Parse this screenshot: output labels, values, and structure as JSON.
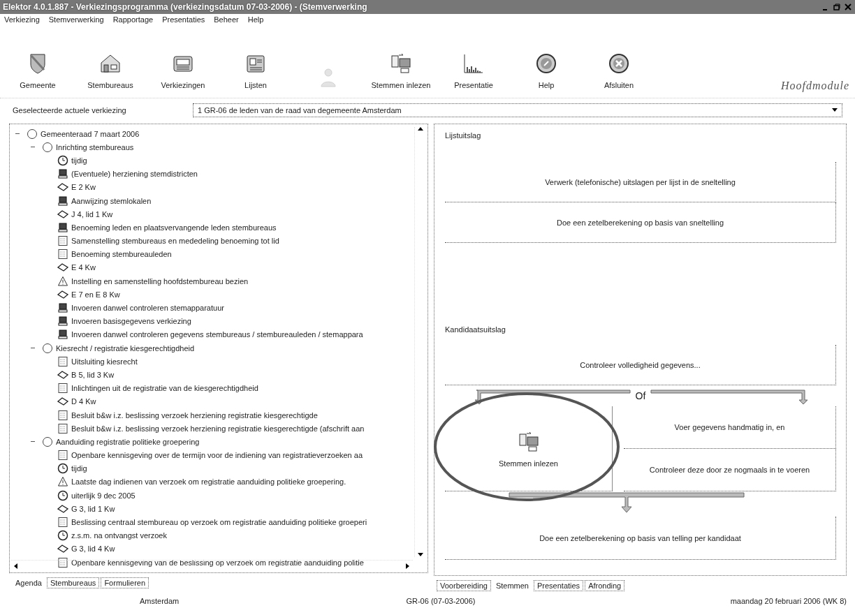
{
  "window": {
    "title": "Elektor 4.0.1.887 - Verkiezingsprogramma (verkiezingsdatum 07-03-2006) - (Stemverwerking"
  },
  "menu": [
    "Verkiezing",
    "Stemverwerking",
    "Rapportage",
    "Presentaties",
    "Beheer",
    "Help"
  ],
  "toolbar": [
    {
      "label": "Gemeente",
      "disabled": false
    },
    {
      "label": "Stembureaus",
      "disabled": false
    },
    {
      "label": "Verkiezingen",
      "disabled": false
    },
    {
      "label": "Lijsten",
      "disabled": false
    },
    {
      "disabled": true
    },
    {
      "label": "Stemmen inlezen",
      "disabled": false
    },
    {
      "label": "Presentatie",
      "disabled": false
    },
    {
      "label": "Help",
      "disabled": false
    },
    {
      "label": "Afsluiten",
      "disabled": false
    }
  ],
  "module_title": "Hoofdmodule",
  "election_select": {
    "label": "Geselecteerde actuele verkiezing",
    "value": "1  GR-06  de leden van de raad van degemeente Amsterdam"
  },
  "agenda_tree": [
    {
      "label": "Gemeenteraad 7 maart 2006",
      "kind": "group",
      "expanded": true,
      "children": [
        {
          "label": "Inrichting stembureaus",
          "kind": "group",
          "expanded": true,
          "children": [
            {
              "label": "tijdig",
              "kind": "clock"
            },
            {
              "label": "(Eventuele) herziening stemdistricten",
              "kind": "computer"
            },
            {
              "label": "E 2 Kw",
              "kind": "law"
            },
            {
              "label": "Aanwijzing stemlokalen",
              "kind": "computer"
            },
            {
              "label": "J 4, lid 1 Kw",
              "kind": "law"
            },
            {
              "label": "Benoeming leden en plaatsvervangende leden stembureaus",
              "kind": "computer"
            },
            {
              "label": "Samenstelling stembureaus en mededeling benoeming tot lid",
              "kind": "form"
            },
            {
              "label": "Benoeming stembureauleden",
              "kind": "form"
            },
            {
              "label": "E 4 Kw",
              "kind": "law"
            },
            {
              "label": "Instelling en samenstelling hoofdstembureau bezien",
              "kind": "warning"
            },
            {
              "label": "E 7 en E 8 Kw",
              "kind": "law"
            },
            {
              "label": "Invoeren danwel controleren stemapparatuur",
              "kind": "computer"
            },
            {
              "label": "Invoeren basisgegevens verkiezing",
              "kind": "computer"
            },
            {
              "label": "Invoeren danwel controleren gegevens stembureaus / stembureauleden / stemappara",
              "kind": "computer"
            }
          ]
        },
        {
          "label": "Kiesrecht / registratie kiesgerechtigdheid",
          "kind": "group",
          "expanded": true,
          "children": [
            {
              "label": "Uitsluiting kiesrecht",
              "kind": "form"
            },
            {
              "label": "B 5, lid 3 Kw",
              "kind": "law"
            },
            {
              "label": "Inlichtingen uit de registratie van de kiesgerechtigdheid",
              "kind": "form"
            },
            {
              "label": "D 4 Kw",
              "kind": "law"
            },
            {
              "label": "Besluit b&w i.z. beslissing verzoek herziening registratie kiesgerechtigde",
              "kind": "form"
            },
            {
              "label": "Besluit b&w i.z. beslissing verzoek herziening registratie kiesgerechtigde (afschrift aan",
              "kind": "form"
            }
          ]
        },
        {
          "label": "Aanduiding registratie politieke groepering",
          "kind": "group",
          "expanded": true,
          "children": [
            {
              "label": "Openbare kennisgeving over de termijn voor de indiening van registratieverzoeken aa",
              "kind": "form"
            },
            {
              "label": "tijdig",
              "kind": "clock"
            },
            {
              "label": "Laatste dag indienen van verzoek om registratie aanduiding politieke groepering.",
              "kind": "warning"
            },
            {
              "label": "uiterlijk 9 dec 2005",
              "kind": "clock"
            },
            {
              "label": "G 3, lid 1 Kw",
              "kind": "law"
            },
            {
              "label": "Beslissing centraal stembureau op verzoek om registratie aanduiding politieke groeperi",
              "kind": "form"
            },
            {
              "label": "z.s.m. na ontvangst verzoek",
              "kind": "clock"
            },
            {
              "label": "G 3, lid 4 Kw",
              "kind": "law"
            },
            {
              "label": "Openbare kennisgeving van de beslissing op verzoek om registratie aanduiding politie",
              "kind": "form"
            }
          ]
        }
      ]
    }
  ],
  "left_tabs": [
    {
      "label": "Agenda",
      "selected": true
    },
    {
      "label": "Stembureaus",
      "selected": false
    },
    {
      "label": "Formulieren",
      "selected": false
    }
  ],
  "list_result": {
    "title": "Lijstuitslag",
    "steps": [
      "Verwerk (telefonische) uitslagen per lijst in de sneltelling",
      "Doe een zetelberekening op basis van sneltelling"
    ]
  },
  "candidate_result": {
    "title": "Kandidaatsuitslag",
    "check": "Controleer volledigheid gegevens...",
    "or": "Of",
    "scan_option": {
      "label": "Stemmen inlezen",
      "circled": true
    },
    "manual_steps": [
      "Voer gegevens handmatig in, en",
      "Controleer deze door ze nogmaals in te voeren"
    ],
    "final": "Doe een zetelberekening op basis van telling per kandidaat"
  },
  "right_tabs": [
    {
      "label": "Voorbereiding",
      "selected": false
    },
    {
      "label": "Stemmen",
      "selected": true
    },
    {
      "label": "Presentaties",
      "selected": false
    },
    {
      "label": "Afronding",
      "selected": false
    }
  ],
  "status_bar": [
    "Amsterdam",
    "GR-06 (07-03-2006)",
    "maandag 20 februari 2006 (WK 8)"
  ]
}
